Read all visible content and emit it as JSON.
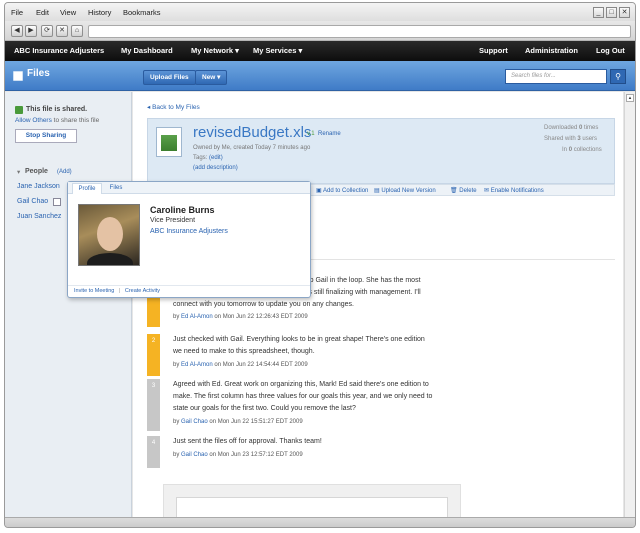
{
  "menu": [
    "File",
    "Edit",
    "View",
    "History",
    "Bookmarks"
  ],
  "window_controls": {
    "minimize": "_",
    "maximize": "□",
    "close": "✕"
  },
  "topnav": {
    "brand": "ABC Insurance Adjusters",
    "dashboard": "My Dashboard",
    "network": "My Network ▾",
    "services": "My Services ▾",
    "support": "Support",
    "administration": "Administration",
    "logout": "Log Out"
  },
  "banner": {
    "title": "Files",
    "upload": "Upload Files",
    "new": "New ▾",
    "search_placeholder": "Search files for..."
  },
  "sidebar": {
    "shared_title": "This file is shared.",
    "allow_others_link": "Allow Others",
    "allow_others_rest": "to share this file",
    "stop_sharing": "Stop Sharing",
    "people_label": "People",
    "add": "(Add)",
    "people": [
      "Jane Jackson",
      "Gail Chao",
      "Juan Sanchez"
    ]
  },
  "file": {
    "back": "Back to My Files",
    "name": "revisedBudget.xls",
    "version": "v.1",
    "rename": "Rename",
    "owned_by": "Owned by Me",
    "created": ", created Today 7 minutes ago",
    "tags": "Tags:",
    "edit": "(edit)",
    "add_description": "(add description)",
    "downloaded_label": "Downloaded",
    "downloaded_count": "0",
    "downloaded_unit": "times",
    "shared_label": "Shared with",
    "shared_count": "3",
    "shared_unit": "users",
    "in_label": "In",
    "in_count": "0",
    "in_unit": "collections"
  },
  "actions": {
    "add_collection": "Add to Collection",
    "upload_version": "Upload New Version",
    "delete": "Delete",
    "notifications": "Enable Notifications"
  },
  "comments": [
    {
      "num": "1",
      "lines": [
        "se keep Gail in the loop. She has the most",
        "recent figures on the proposed budget and is still finalizing with management. I'll",
        "connect with you tomorrow to update you on any changes."
      ],
      "author": "Ed Al-Amon",
      "date": "on Mon Jun 22 12:26:43 EDT 2009"
    },
    {
      "num": "2",
      "lines": [
        "Just checked with Gail. Everything looks to be in great shape! There's one edition",
        "we need to make to this spreadsheet, though."
      ],
      "author": "Ed Al-Amon",
      "date": "on Mon Jun 22 14:54:44 EDT 2009"
    },
    {
      "num": "3",
      "lines": [
        "Agreed with Ed. Great work on organizing this, Mark! Ed said there's one edition to",
        "make. The first column has three values for our goals this year, and we only need to",
        "state our goals for the first two. Could you remove the last?"
      ],
      "author": "Gail Chao",
      "date": "on Mon Jun 22 15:51:27 EDT 2009"
    },
    {
      "num": "4",
      "lines": [
        "Just sent the files off for approval. Thanks team!"
      ],
      "author": "Gail Chao",
      "date": "on Mon Jun 23 12:57:12 EDT 2009"
    }
  ],
  "popup": {
    "tab_profile": "Profile",
    "tab_files": "Files",
    "name": "Caroline Burns",
    "title": "Vice President",
    "company": "ABC Insurance Adjusters",
    "invite": "Invite to Meeting",
    "sep": "|",
    "create_activity": "Create Activity"
  },
  "colors": {
    "accent": "#3f7bc7",
    "highlight": "#f5b323",
    "link": "#2a63b0"
  }
}
